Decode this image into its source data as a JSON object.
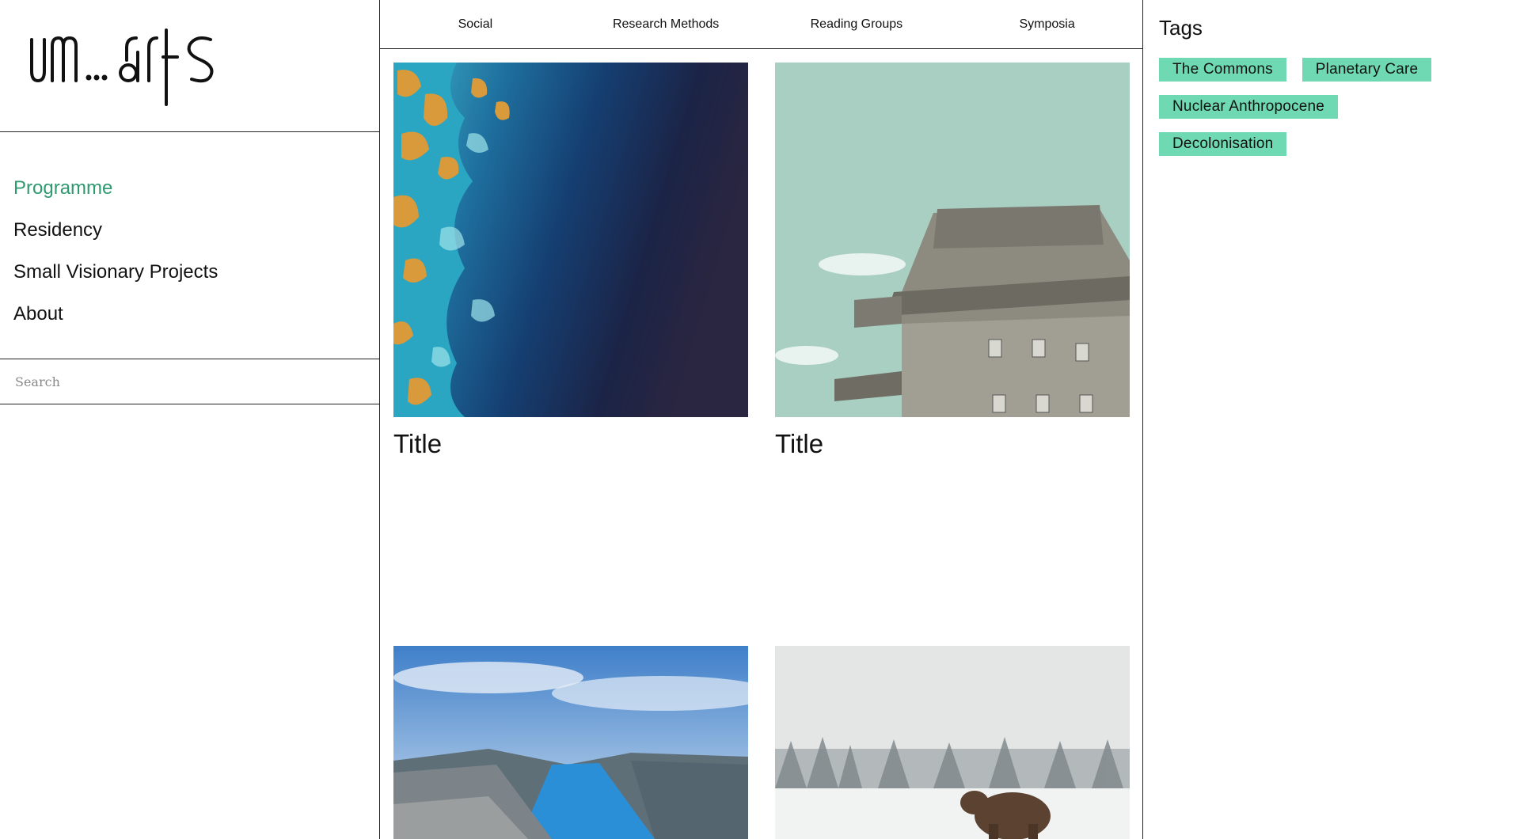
{
  "brand": {
    "logo_text": "um...arts"
  },
  "sidebar": {
    "nav": [
      {
        "label": "Programme",
        "active": true
      },
      {
        "label": "Residency",
        "active": false
      },
      {
        "label": "Small Visionary Projects",
        "active": false
      },
      {
        "label": "About",
        "active": false
      }
    ],
    "search_placeholder": "Search"
  },
  "top_nav": [
    "Social",
    "Research Methods",
    "Reading Groups",
    "Symposia"
  ],
  "cards": [
    {
      "title": "Title",
      "image": "ocean-satellite"
    },
    {
      "title": "Title",
      "image": "concrete-bunker"
    },
    {
      "title": "",
      "image": "fjord"
    },
    {
      "title": "",
      "image": "bear-in-snow"
    }
  ],
  "tags": {
    "heading": "Tags",
    "items": [
      "The Commons",
      "Planetary Care",
      "Nuclear Anthropocene",
      "Decolonisation"
    ]
  },
  "colors": {
    "accent": "#2f9a6f",
    "tag_bg": "#6ed9b2"
  }
}
